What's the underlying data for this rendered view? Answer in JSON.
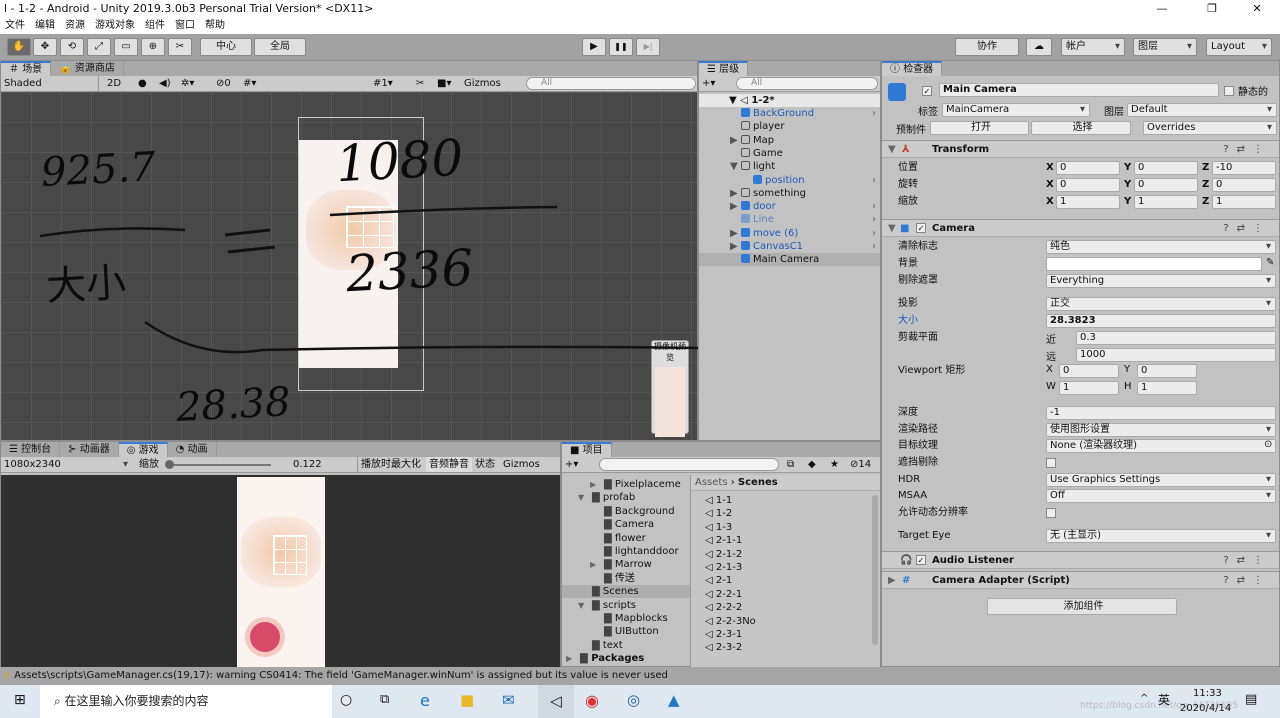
{
  "window": {
    "title": "l - 1-2 - Android - Unity 2019.3.0b3 Personal Trial Version* <DX11>",
    "controls": [
      "—",
      "❐",
      "✕"
    ]
  },
  "menu": [
    "文件",
    "编辑",
    "资源",
    "游戏对象",
    "组件",
    "窗口",
    "帮助"
  ],
  "toolbar": {
    "tools": [
      "✋",
      "✥",
      "⟲",
      "⤢",
      "▭",
      "⊕",
      "✂"
    ],
    "pivot": "中心",
    "space": "全局",
    "play": "▶",
    "pause": "❚❚",
    "step": "▶|",
    "collab": "协作",
    "cloud": "☁",
    "account": "帐户",
    "layers": "图层",
    "layout": "Layout"
  },
  "scene": {
    "tabs": [
      "场景",
      "资源商店"
    ],
    "shading": "Shaded",
    "mode2d": "2D",
    "hidden_count": "0",
    "grid_count": "1",
    "gizmos": "Gizmos",
    "search_placeholder": "All",
    "camera_preview_label": "摄像机预览",
    "annotations": [
      "925.7",
      "1080",
      "大小",
      "2336",
      "28.38"
    ]
  },
  "hierarchy": {
    "tab": "层级",
    "search_placeholder": "All",
    "scene": "1-2*",
    "items": [
      {
        "name": "BackGround",
        "prefab": true,
        "arrow": false,
        "indent": 1
      },
      {
        "name": "player",
        "prefab": false,
        "arrow": false,
        "indent": 1
      },
      {
        "name": "Map",
        "prefab": false,
        "arrow": true,
        "indent": 1
      },
      {
        "name": "Game",
        "prefab": false,
        "arrow": false,
        "indent": 1
      },
      {
        "name": "light",
        "prefab": false,
        "arrow": true,
        "indent": 1
      },
      {
        "name": "position",
        "prefab": true,
        "arrow": false,
        "indent": 2
      },
      {
        "name": "something",
        "prefab": false,
        "arrow": true,
        "indent": 1
      },
      {
        "name": "door",
        "prefab": true,
        "arrow": true,
        "indent": 1
      },
      {
        "name": "Line",
        "prefab": true,
        "arrow": false,
        "indent": 1
      },
      {
        "name": "move (6)",
        "prefab": true,
        "arrow": true,
        "indent": 1
      },
      {
        "name": "CanvasC1",
        "prefab": true,
        "arrow": true,
        "indent": 1
      },
      {
        "name": "Main Camera",
        "prefab": true,
        "arrow": false,
        "indent": 1,
        "selected": true
      }
    ]
  },
  "inspector": {
    "tab": "检查器",
    "object_name": "Main Camera",
    "static_label": "静态的",
    "tag_label": "标签",
    "tag": "MainCamera",
    "layer_label": "图层",
    "layer": "Default",
    "prefab_label": "预制件",
    "open": "打开",
    "select": "选择",
    "overrides": "Overrides",
    "transform": {
      "title": "Transform",
      "rows": [
        {
          "label": "位置",
          "x": "0",
          "y": "0",
          "z": "-10"
        },
        {
          "label": "旋转",
          "x": "0",
          "y": "0",
          "z": "0"
        },
        {
          "label": "缩放",
          "x": "1",
          "y": "1",
          "z": "1"
        }
      ]
    },
    "camera": {
      "title": "Camera",
      "clear_flags_label": "清除标志",
      "clear_flags": "纯色",
      "background_label": "背景",
      "culling_label": "剔除遮罩",
      "culling": "Everything",
      "projection_label": "投影",
      "projection": "正交",
      "size_label": "大小",
      "size": "28.3823",
      "clipping_label": "剪裁平面",
      "near_label": "近",
      "near": "0.3",
      "far_label": "远",
      "far": "1000",
      "viewport_label": "Viewport 矩形",
      "vx": "0",
      "vy": "0",
      "vw": "1",
      "vh": "1",
      "depth_label": "深度",
      "depth": "-1",
      "render_path_label": "渲染路径",
      "render_path": "使用图形设置",
      "target_texture_label": "目标纹理",
      "target_texture": "None (渲染器纹理)",
      "occlusion_label": "遮挡剔除",
      "hdr_label": "HDR",
      "hdr": "Use Graphics Settings",
      "msaa_label": "MSAA",
      "msaa": "Off",
      "dynres_label": "允许动态分辨率",
      "target_eye_label": "Target Eye",
      "target_eye": "无 (主显示)"
    },
    "audio_listener": "Audio Listener",
    "camera_adapter": "Camera Adapter (Script)",
    "add_component": "添加组件"
  },
  "game": {
    "tabs": [
      "控制台",
      "动画器",
      "游戏",
      "动画"
    ],
    "resolution": "1080x2340",
    "scale_label": "缩放",
    "scale": "0.122",
    "scale_fraction": 0.0,
    "maximize": "播放时最大化",
    "mute": "音频静音",
    "stats": "状态",
    "gizmos": "Gizmos"
  },
  "project": {
    "tab": "项目",
    "hidden_count": "14",
    "breadcrumb": [
      "Assets",
      "Scenes"
    ],
    "tree": [
      {
        "name": "Pixelplaceme",
        "indent": 2,
        "arrow": "▶"
      },
      {
        "name": "profab",
        "indent": 1,
        "arrow": "▼"
      },
      {
        "name": "Background",
        "indent": 2,
        "arrow": ""
      },
      {
        "name": "Camera",
        "indent": 2,
        "arrow": ""
      },
      {
        "name": "flower",
        "indent": 2,
        "arrow": ""
      },
      {
        "name": "lightanddoor",
        "indent": 2,
        "arrow": ""
      },
      {
        "name": "Marrow",
        "indent": 2,
        "arrow": "▶"
      },
      {
        "name": "传送",
        "indent": 2,
        "arrow": ""
      },
      {
        "name": "Scenes",
        "indent": 1,
        "arrow": "",
        "selected": true
      },
      {
        "name": "scripts",
        "indent": 1,
        "arrow": "▼"
      },
      {
        "name": "Mapblocks",
        "indent": 2,
        "arrow": ""
      },
      {
        "name": "UIButton",
        "indent": 2,
        "arrow": ""
      },
      {
        "name": "text",
        "indent": 1,
        "arrow": ""
      },
      {
        "name": "Packages",
        "indent": 0,
        "arrow": "▶",
        "bold": true
      }
    ],
    "files": [
      "1-1",
      "1-2",
      "1-3",
      "2-1-1",
      "2-1-2",
      "2-1-3",
      "2-1",
      "2-2-1",
      "2-2-2",
      "2-2-3No",
      "2-3-1",
      "2-3-2"
    ]
  },
  "status": {
    "message": "Assets\\scripts\\GameManager.cs(19,17): warning CS0414: The field 'GameManager.winNum' is assigned but its value is never used"
  },
  "taskbar": {
    "search_placeholder": "在这里输入你要搜索的内容",
    "ime": "英",
    "time": "11:33",
    "date": "2020/4/14",
    "watermark": "https://blog.csdn.net/qq_44736595"
  }
}
